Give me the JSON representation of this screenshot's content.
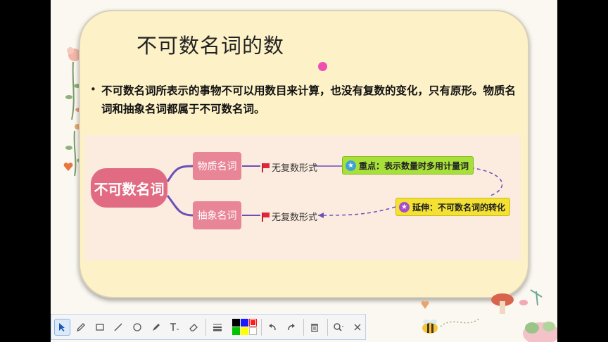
{
  "slide": {
    "title": "不可数名词的数",
    "bullet": "•",
    "paragraph": "不可数名词所表示的事物不可以用数目来计算，也没有复数的变化，只有原形。物质名词和抽象名词都属于不可数名词。"
  },
  "mindmap": {
    "root": "不可数名词",
    "branches": [
      {
        "label": "物质名词",
        "detail": "无复数形式"
      },
      {
        "label": "抽象名词",
        "detail": "无复数形式"
      }
    ],
    "notes": [
      {
        "text": "重点：表示数量时多用计量词",
        "color": "#a8e03a"
      },
      {
        "text": "延伸：不可数名词的转化",
        "color": "#f3e133"
      }
    ]
  },
  "toolbar": {
    "tools": [
      "select-tool",
      "pen-tool",
      "rectangle-tool",
      "line-tool",
      "circle-tool",
      "highlighter-tool",
      "text-tool",
      "eraser-tool",
      "line-width-tool",
      "undo",
      "redo",
      "delete",
      "zoom",
      "close"
    ],
    "colors": [
      "#000000",
      "#1a1aff",
      "#ff1a1a",
      "#00c400",
      "#ffff00",
      "#ffffff"
    ],
    "selected_color": "#ff1a1a"
  },
  "colors": {
    "card_bg": "#fdf1c7",
    "root_node": "#e16b82",
    "branch_node": "#e88596",
    "connector": "#6b4fb8"
  }
}
